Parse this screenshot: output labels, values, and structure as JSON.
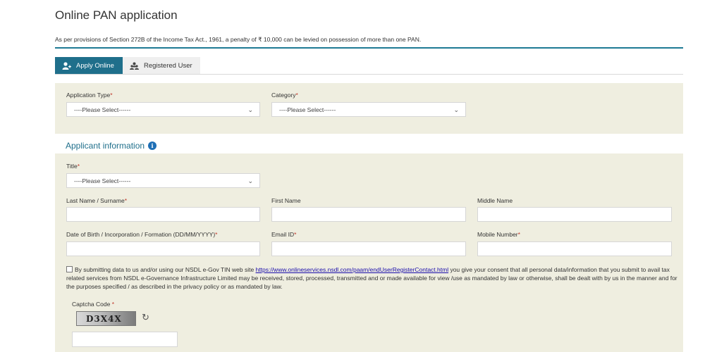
{
  "page": {
    "title": "Online PAN application",
    "notice": "As per provisions of Section 272B of the Income Tax Act., 1961, a penalty of ₹ 10,000 can be levied on possession of more than one PAN."
  },
  "tabs": [
    {
      "label": "Apply Online",
      "icon": "user-plus-icon",
      "active": true
    },
    {
      "label": "Registered User",
      "icon": "users-icon",
      "active": false
    }
  ],
  "application": {
    "type_label": "Application Type",
    "type_value": "----Please Select------",
    "category_label": "Category",
    "category_value": "----Please Select------",
    "required_mark": "*"
  },
  "applicant": {
    "header": "Applicant information",
    "info_icon": "i",
    "title_label": "Title",
    "title_value": "----Please Select------",
    "last_name_label": "Last Name / Surname",
    "first_name_label": "First Name",
    "middle_name_label": "Middle Name",
    "dob_label": "Date of Birth / Incorporation / Formation (DD/MM/YYYY)",
    "email_label": "Email ID",
    "mobile_label": "Mobile Number",
    "last_name_value": "",
    "first_name_value": "",
    "middle_name_value": "",
    "dob_value": "",
    "email_value": "",
    "mobile_value": ""
  },
  "consent": {
    "text_before": "By submitting data to us and/or using our NSDL e-Gov TIN web site ",
    "link": "https://www.onlineservices.nsdl.com/paam/endUserRegisterContact.html",
    "text_after": " you give your consent that all personal data/information that you submit to avail tax related services from NSDL e-Governance Infrastructure Limited may be received, stored, processed, transmitted and or made available for view /use as mandated by law or otherwise, shall be dealt with by us in the manner and for the purposes specified / as described in the privacy policy or as mandated by law."
  },
  "captcha": {
    "label": "Captcha Code",
    "code": "D3X4X",
    "value": ""
  },
  "colors": {
    "accent": "#1f6f8b",
    "panel": "#efeee0",
    "required": "#c0392b",
    "link": "#1a0dab"
  }
}
